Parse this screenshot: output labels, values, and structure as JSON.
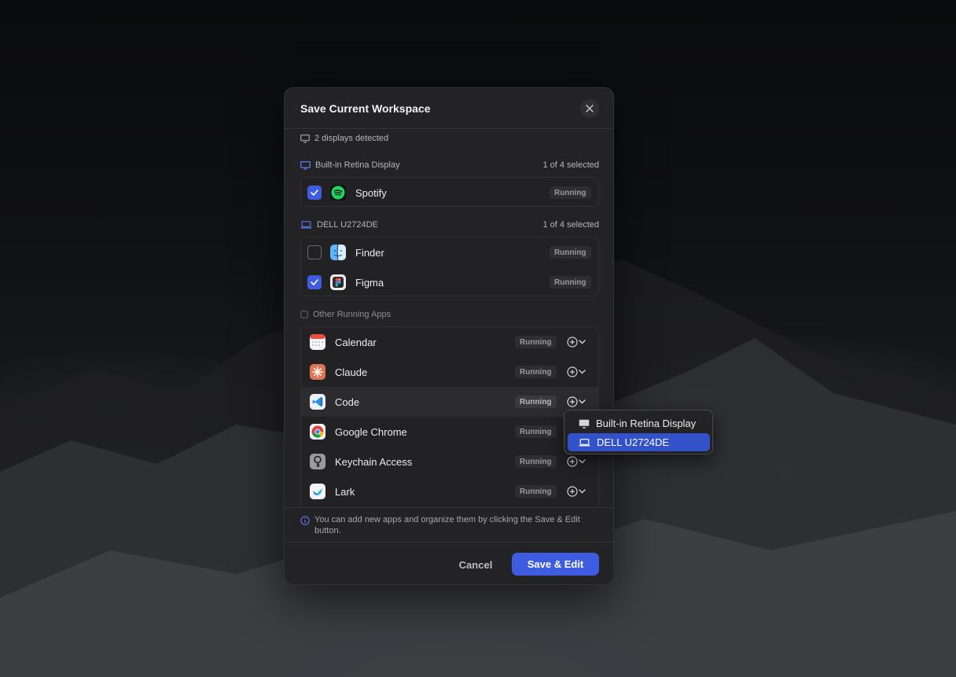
{
  "dialog": {
    "title": "Save Current Workspace",
    "detected": "2 displays detected",
    "info": "You can add new apps and organize them by clicking the Save & Edit button.",
    "cancel_label": "Cancel",
    "save_label": "Save & Edit"
  },
  "displays": [
    {
      "name": "Built-in Retina Display",
      "count": "1 of 4 selected",
      "apps": [
        {
          "name": "Spotify",
          "status": "Running",
          "checked": true
        }
      ]
    },
    {
      "name": "DELL U2724DE",
      "count": "1 of 4 selected",
      "apps": [
        {
          "name": "Finder",
          "status": "Running",
          "checked": false
        },
        {
          "name": "Figma",
          "status": "Running",
          "checked": true
        }
      ]
    }
  ],
  "other": {
    "title": "Other Running Apps",
    "apps": [
      {
        "name": "Calendar",
        "status": "Running",
        "icon": "calendar-icon"
      },
      {
        "name": "Claude",
        "status": "Running",
        "icon": "claude-icon"
      },
      {
        "name": "Code",
        "status": "Running",
        "icon": "vscode-icon"
      },
      {
        "name": "Google Chrome",
        "status": "Running",
        "icon": "chrome-icon"
      },
      {
        "name": "Keychain Access",
        "status": "Running",
        "icon": "keychain-icon"
      },
      {
        "name": "Lark",
        "status": "Running",
        "icon": "lark-icon"
      }
    ]
  },
  "menu": {
    "items": [
      {
        "label": "Built-in Retina Display",
        "icon": "monitor-icon",
        "selected": false
      },
      {
        "label": "DELL U2724DE",
        "icon": "laptop-icon",
        "selected": true
      }
    ]
  },
  "colors": {
    "accent": "#3d5ce0",
    "dialog_bg": "#232325"
  }
}
